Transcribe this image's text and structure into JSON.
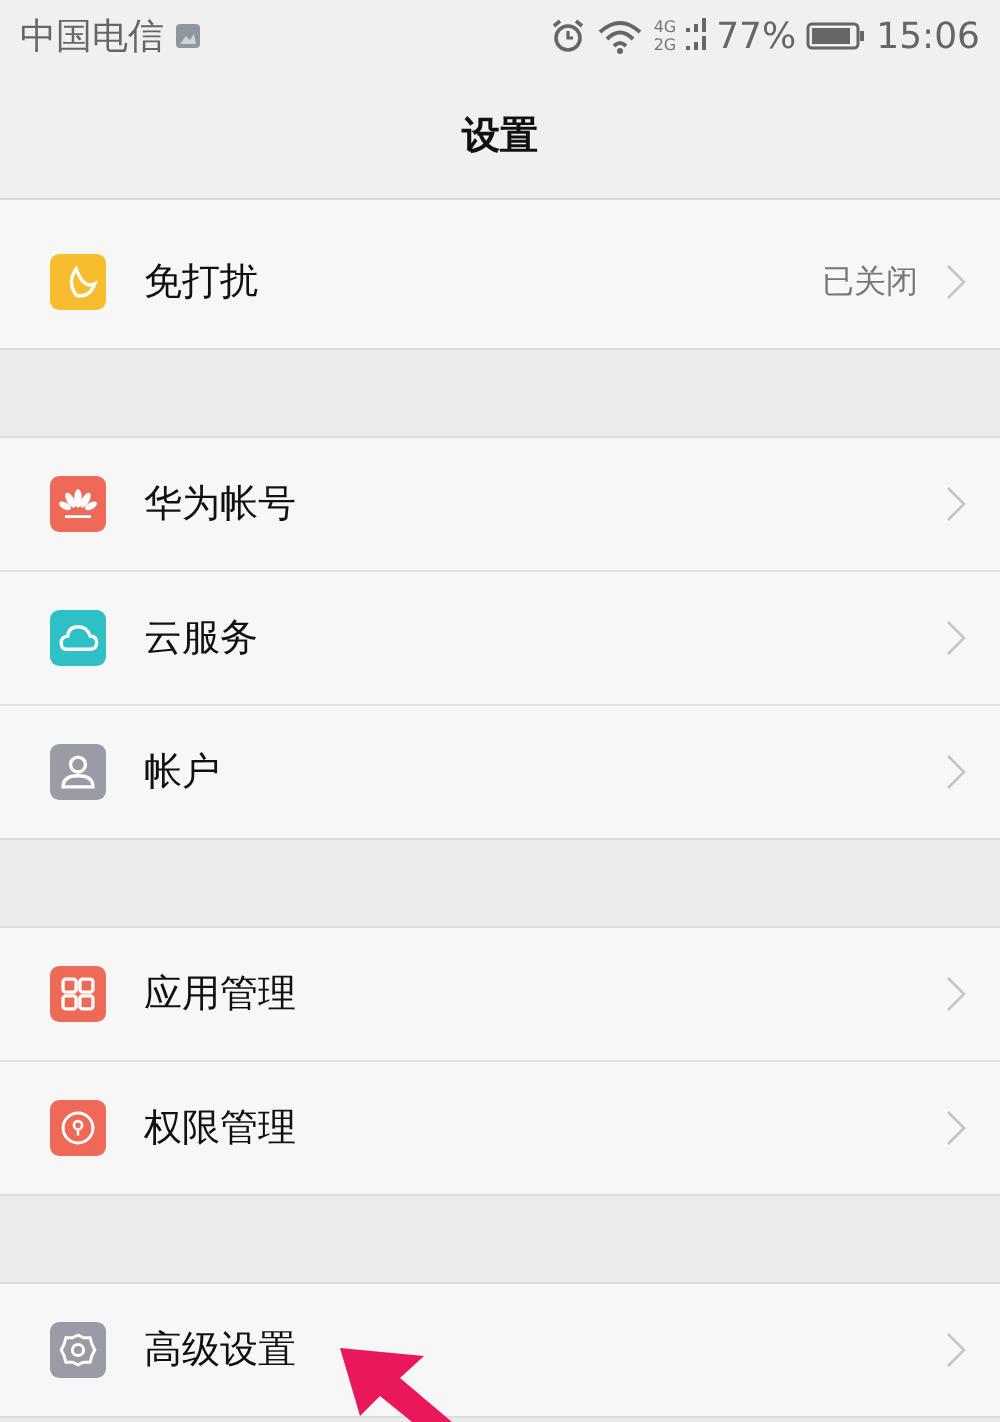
{
  "status_bar": {
    "carrier": "中国电信",
    "network_top": "4G",
    "network_bottom": "2G",
    "battery": "77%",
    "time": "15:06"
  },
  "title": "设置",
  "groups": [
    {
      "items": [
        {
          "kind": "moon",
          "label": "免打扰",
          "value": "已关闭"
        }
      ]
    },
    {
      "items": [
        {
          "kind": "flower",
          "label": "华为帐号"
        },
        {
          "kind": "cloud",
          "label": "云服务"
        },
        {
          "kind": "person",
          "label": "帐户"
        }
      ]
    },
    {
      "items": [
        {
          "kind": "apps",
          "label": "应用管理"
        },
        {
          "kind": "keyhole",
          "label": "权限管理"
        }
      ]
    },
    {
      "items": [
        {
          "kind": "gear",
          "label": "高级设置"
        }
      ]
    }
  ]
}
